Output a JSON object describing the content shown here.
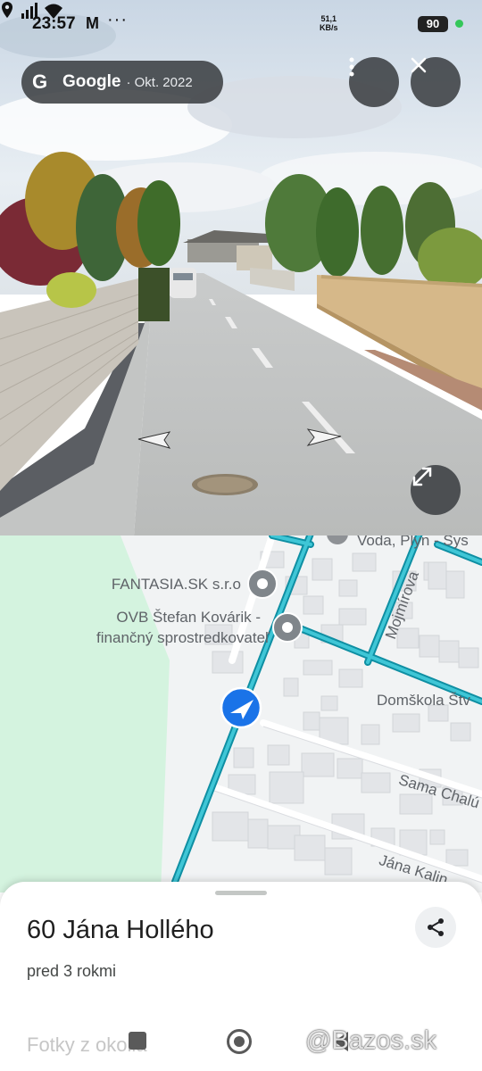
{
  "status_bar": {
    "time": "23:57",
    "speed_value": "51,1",
    "speed_unit": "KB/s",
    "battery": "90"
  },
  "street_view": {
    "brand": "Google",
    "date": "· Okt. 2022",
    "more_icon": "more-vert-icon",
    "close_icon": "close-icon",
    "expand_icon": "expand-icon"
  },
  "map": {
    "pois": [
      {
        "label": "Voda, Plyn - Sys"
      },
      {
        "label": "FANTASIA.SK s.r.o"
      },
      {
        "label_line1": "OVB Štefan Kovárik -",
        "label_line2": "finančný sprostredkovateľ"
      }
    ],
    "places": {
      "school": "Domškola Štv"
    },
    "roads": {
      "mojmirova": "Mojmírova",
      "sama": "Sama Chalú",
      "jana": "Jána Kalin"
    },
    "colors": {
      "road_highlight": "#12a5b8",
      "park": "#d4f3df",
      "location_marker": "#1a73e8"
    }
  },
  "place": {
    "title": "60 Jána Hollého",
    "subtitle": "pred 3 rokmi",
    "section": "Fotky z okolia",
    "share_icon": "share-icon"
  },
  "watermark": "@Bazos.sk"
}
